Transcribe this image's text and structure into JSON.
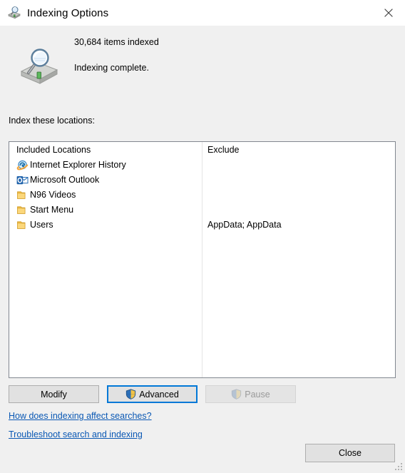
{
  "window": {
    "title": "Indexing Options",
    "title_icon": "indexing-options-icon",
    "close_icon": "close-icon"
  },
  "status": {
    "icon": "drive-search-icon",
    "items_indexed": "30,684 items indexed",
    "state": "Indexing complete."
  },
  "section": {
    "label": "Index these locations:"
  },
  "list": {
    "columns": [
      "Included Locations",
      "Exclude"
    ],
    "rows": [
      {
        "icon": "internet-explorer-icon",
        "label": "Internet Explorer History",
        "exclude": ""
      },
      {
        "icon": "outlook-icon",
        "label": "Microsoft Outlook",
        "exclude": ""
      },
      {
        "icon": "folder-icon",
        "label": "N96 Videos",
        "exclude": ""
      },
      {
        "icon": "folder-icon",
        "label": "Start Menu",
        "exclude": ""
      },
      {
        "icon": "folder-icon",
        "label": "Users",
        "exclude": "AppData; AppData"
      }
    ]
  },
  "buttons": {
    "modify": "Modify",
    "advanced": "Advanced",
    "pause": "Pause",
    "close": "Close",
    "advanced_icon": "uac-shield-icon",
    "pause_icon": "uac-shield-icon"
  },
  "links": {
    "how_does": "How does indexing affect searches?",
    "troubleshoot": "Troubleshoot search and indexing"
  },
  "colors": {
    "focus_border": "#0078d7",
    "link": "#0a58b4",
    "window_body": "#f0f0f0",
    "titlebar": "#ffffff",
    "listbox_bg": "#ffffff",
    "disabled_text": "#9a9a9a"
  }
}
